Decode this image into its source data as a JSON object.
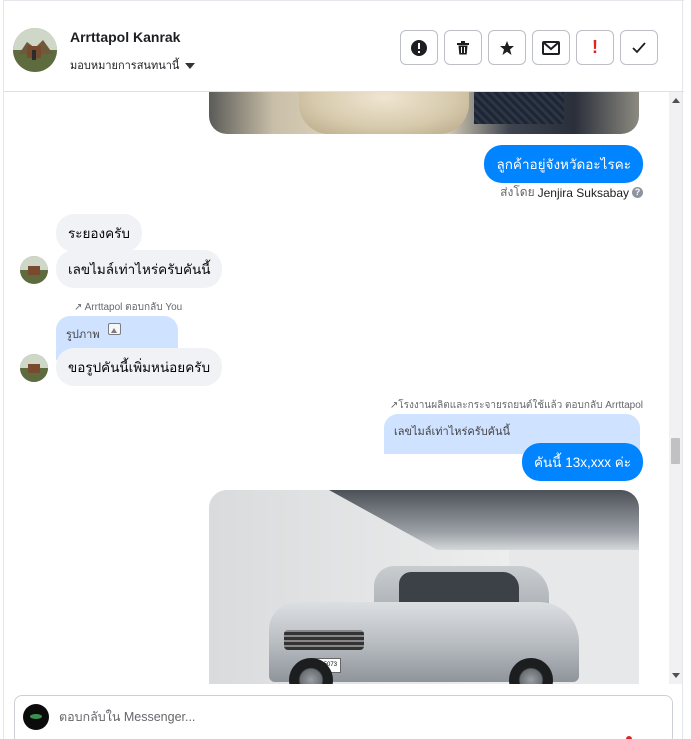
{
  "header": {
    "name": "Arrttapol Kanrak",
    "assign_label": "มอบหมายการสนทนานี้",
    "actions": {
      "report": "!",
      "delete": "🗑",
      "star": "★",
      "mail": "✉",
      "spam": "!",
      "done": "✓"
    }
  },
  "messages": {
    "out_question": "ลูกค้าอยู่จังหวัดอะไรคะ",
    "sent_by_prefix": "ส่งโดย",
    "sent_by_name": "Jenjira Suksabay",
    "help": "?",
    "in_1": "ระยองครับ",
    "in_2": "เลขไมล์เท่าไหร่ครับคันนี้",
    "in_reply_meta": "Arrttapol ตอบกลับ You",
    "in_reply_quote": "รูปภาพ",
    "in_3": "ขอรูปคันนี้เพิ่มหน่อยครับ",
    "out_reply_meta": "โรงงานผลิตและกระจายรถยนต์ใช้แล้ว ตอบกลับ Arrttapol",
    "out_reply_quote": "เลขไมล์เท่าไหร่ครับคันนี้",
    "out_answer": "คันนี้ 13x,xxx ค่ะ",
    "car_plate": "กจ 5073"
  },
  "composer": {
    "placeholder": "ตอบกลับใน Messenger..."
  },
  "colors": {
    "accent": "#0084ff",
    "incoming_bubble": "#f0f2f5",
    "reply_quote": "#cfe2ff"
  }
}
